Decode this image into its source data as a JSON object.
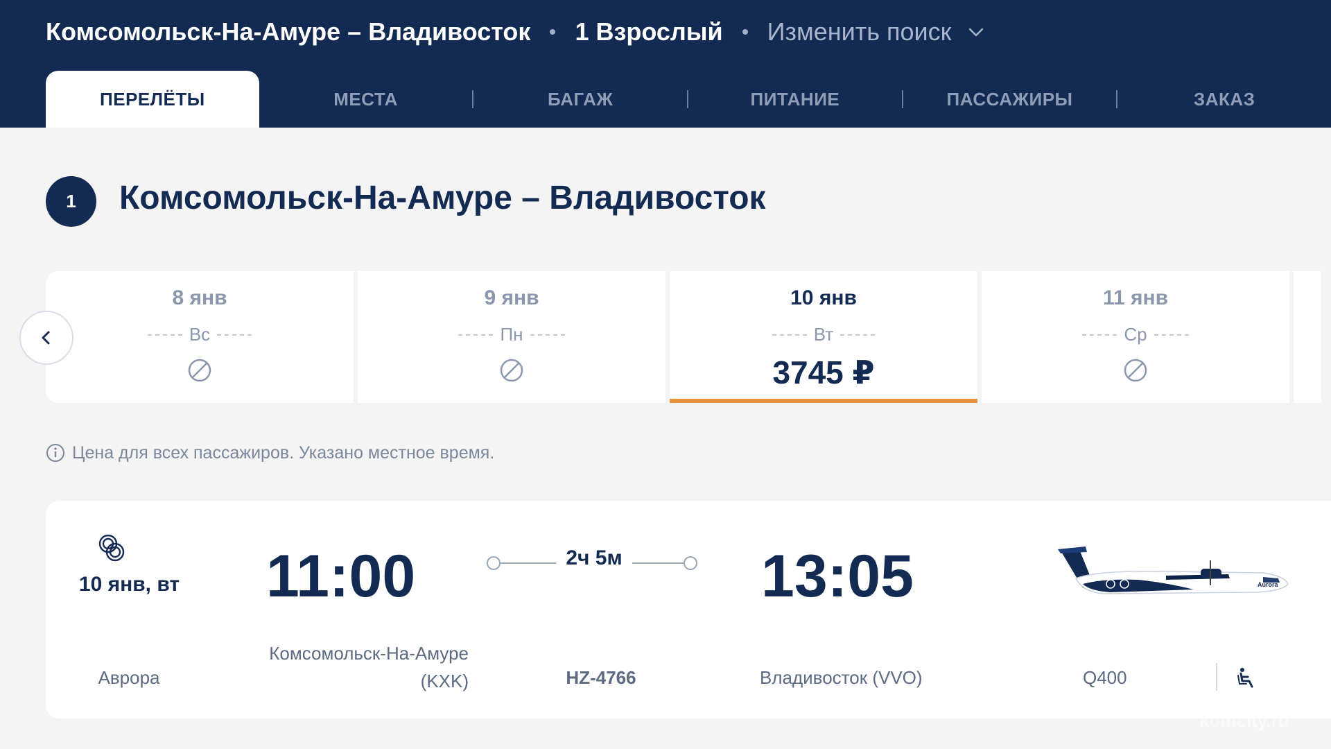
{
  "header": {
    "route": "Комсомольск-На-Амуре  –  Владивосток",
    "passengers": "1 Взрослый",
    "change_search": "Изменить поиск",
    "tabs": [
      {
        "label": "ПЕРЕЛЁТЫ",
        "active": true
      },
      {
        "label": "МЕСТА"
      },
      {
        "label": "БАГАЖ"
      },
      {
        "label": "ПИТАНИЕ"
      },
      {
        "label": "ПАССАЖИРЫ"
      },
      {
        "label": "ЗАКАЗ"
      }
    ]
  },
  "section": {
    "step": "1",
    "title": "Комсомольск-На-Амуре – Владивосток"
  },
  "dates": [
    {
      "date": "8 янв",
      "dow": "Вс",
      "available": false
    },
    {
      "date": "9 янв",
      "dow": "Пн",
      "available": false
    },
    {
      "date": "10 янв",
      "dow": "Вт",
      "price": "3745 ₽",
      "selected": true
    },
    {
      "date": "11 янв",
      "dow": "Ср",
      "available": false
    }
  ],
  "info_note": "Цена для всех пассажиров. Указано местное время.",
  "flight": {
    "date": "10 янв, вт",
    "departure_time": "11:00",
    "arrival_time": "13:05",
    "duration": "2ч 5м",
    "airline": "Аврора",
    "departure_airport": "Комсомольск-На-Амуре (KXK)",
    "departure_airport_line1": "Комсомольск-На-Амуре",
    "departure_airport_line2": "(KXK)",
    "flight_number": "HZ-4766",
    "arrival_airport": "Владивосток (VVO)",
    "aircraft": "Q400"
  },
  "watermark": "komcity.ru",
  "colors": {
    "navy": "#132a52",
    "accent": "#e8913a",
    "background": "#f4f4f4"
  }
}
